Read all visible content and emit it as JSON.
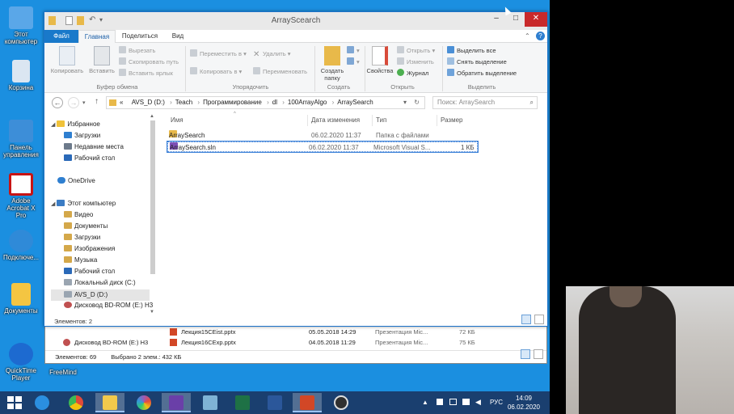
{
  "desktop": {
    "icons": [
      {
        "label": "Этот компьютер",
        "color": "#5aa7e8"
      },
      {
        "label": "Корзина",
        "color": "#dbe6f2"
      },
      {
        "label": "Панель управления",
        "color": "#3d8ed8"
      },
      {
        "label": "Adobe Acrobat X Pro",
        "color": "#c81414"
      },
      {
        "label": "Подключе...",
        "color": "#2f8ad8"
      },
      {
        "label": "Документы",
        "color": "#f4c542"
      },
      {
        "label": "QuickTime Player",
        "color": "#1d6ad0"
      }
    ],
    "freemind_label": "FreeMind"
  },
  "window": {
    "title": "ArrayScearch",
    "tabs": {
      "file": "Файл",
      "home": "Главная",
      "share": "Поделиться",
      "view": "Вид"
    },
    "ribbon": {
      "copy": "Копировать",
      "paste": "Вставить",
      "cut": "Вырезать",
      "copy_path": "Скопировать путь",
      "paste_shortcut": "Вставить ярлык",
      "clipboard_label": "Буфер обмена",
      "move_to": "Переместить в",
      "copy_to": "Копировать в",
      "delete": "Удалить",
      "rename": "Переименовать",
      "organize_label": "Упорядочить",
      "new_folder": "Создать папку",
      "new_label": "Создать",
      "properties": "Свойства",
      "open": "Открыть",
      "edit": "Изменить",
      "history": "Журнал",
      "open_label": "Открыть",
      "select_all": "Выделить все",
      "select_none": "Снять выделение",
      "invert": "Обратить выделение",
      "select_label": "Выделить"
    },
    "address": {
      "prefix": "«",
      "parts": [
        "AVS_D (D:)",
        "Teach",
        "Программирование",
        "dl",
        "100ArrayAlgo",
        "ArraySearch"
      ]
    },
    "search_placeholder": "Поиск: ArraySearch",
    "nav": [
      {
        "label": "Избранное",
        "icon": "star",
        "color": "#f0c23a",
        "indent": 0
      },
      {
        "label": "Загрузки",
        "icon": "folder",
        "color": "#2f7fd0",
        "indent": 1
      },
      {
        "label": "Недавние места",
        "icon": "folder",
        "color": "#6c7a8b",
        "indent": 1
      },
      {
        "label": "Рабочий стол",
        "icon": "folder",
        "color": "#2a69b8",
        "indent": 1
      },
      {
        "label": "OneDrive",
        "icon": "cloud",
        "color": "#2f7fd0",
        "indent": 0
      },
      {
        "label": "Этот компьютер",
        "icon": "pc",
        "color": "#3b7cc4",
        "indent": 0
      },
      {
        "label": "Видео",
        "icon": "folder",
        "color": "#d4a84a",
        "indent": 1
      },
      {
        "label": "Документы",
        "icon": "folder",
        "color": "#d4a84a",
        "indent": 1
      },
      {
        "label": "Загрузки",
        "icon": "folder",
        "color": "#d4a84a",
        "indent": 1
      },
      {
        "label": "Изображения",
        "icon": "folder",
        "color": "#d4a84a",
        "indent": 1
      },
      {
        "label": "Музыка",
        "icon": "folder",
        "color": "#d4a84a",
        "indent": 1
      },
      {
        "label": "Рабочий стол",
        "icon": "folder",
        "color": "#2a69b8",
        "indent": 1
      },
      {
        "label": "Локальный диск (C:)",
        "icon": "drive",
        "color": "#9aa5b1",
        "indent": 1
      },
      {
        "label": "AVS_D (D:)",
        "icon": "drive",
        "color": "#9aa5b1",
        "indent": 1,
        "selected": true
      },
      {
        "label": "Дисковод BD-ROM (E:) H3",
        "icon": "disc",
        "color": "#c05050",
        "indent": 1
      }
    ],
    "columns": {
      "name": "Имя",
      "date": "Дата изменения",
      "type": "Тип",
      "size": "Размер"
    },
    "files": [
      {
        "name": "ArraySearch",
        "date": "06.02.2020 11:37",
        "type": "Папка с файлами",
        "size": "",
        "icon": "folder",
        "color": "#e8b94a"
      },
      {
        "name": "ArraySearch.sln",
        "date": "06.02.2020 11:37",
        "type": "Microsoft Visual S...",
        "size": "1 КБ",
        "icon": "sln",
        "color": "#7d4fb5",
        "focused": true
      }
    ],
    "status": "Элементов: 2"
  },
  "back_window": {
    "rows": [
      {
        "name": "Лекция15CEist.pptx",
        "date": "05.05.2018 14:29",
        "type": "Презентация Mic...",
        "size": "72 КБ"
      },
      {
        "name": "Лекция16CExp.pptx",
        "date": "04.05.2018 11:29",
        "type": "Презентация Mic...",
        "size": "75 КБ"
      }
    ],
    "nav_item": "Дисковод BD-ROM (E:) H3",
    "status_count": "Элементов: 69",
    "status_selected": "Выбрано 2 элем.: 432 КБ"
  },
  "taskbar": {
    "apps": [
      {
        "name": "internet-explorer",
        "color": "#2b8fe0"
      },
      {
        "name": "chrome",
        "color": "#e04b3a"
      },
      {
        "name": "file-explorer",
        "color": "#f2c94c",
        "active": true
      },
      {
        "name": "picasa",
        "color": "#9b59b6"
      },
      {
        "name": "visual-studio",
        "color": "#6a3fa8"
      },
      {
        "name": "notepad",
        "color": "#7fb3d5"
      },
      {
        "name": "excel",
        "color": "#1e7145"
      },
      {
        "name": "word",
        "color": "#2b579a"
      },
      {
        "name": "powerpoint",
        "color": "#d24726"
      },
      {
        "name": "obs",
        "color": "#303030"
      }
    ],
    "lang": "РУС",
    "time": "14:09",
    "date": "06.02.2020"
  }
}
